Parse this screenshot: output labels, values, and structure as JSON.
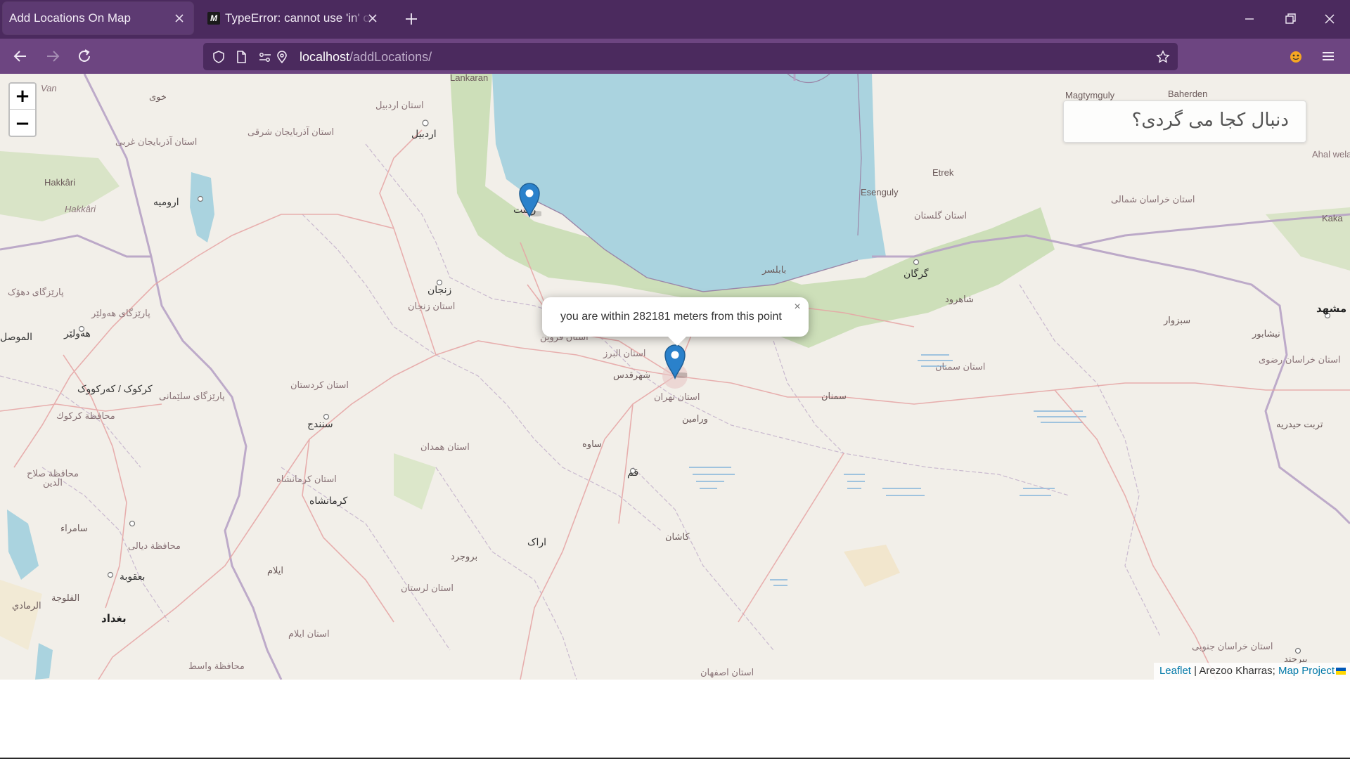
{
  "browser": {
    "tabs": [
      {
        "title": "Add Locations On Map",
        "active": true
      },
      {
        "title": "TypeError: cannot use 'in' operator to search",
        "favicon": "M",
        "active": false
      }
    ],
    "url": {
      "host": "localhost",
      "path": "/addLocations/"
    }
  },
  "colors": {
    "tabbar": "#4b2a5e",
    "navbar": "#6d4581",
    "water": "#aad3df",
    "marker": "#2a81cb"
  },
  "map": {
    "zoom_in_label": "+",
    "zoom_out_label": "−",
    "search_placeholder": "دنبال کجا می گردی؟",
    "popup_text": "you are within 282181 meters from this point",
    "popup_close": "×",
    "attribution": {
      "leaflet": "Leaflet",
      "separator": " | ",
      "author": "Arezoo Kharras; ",
      "project": "Map Project"
    },
    "labels": [
      {
        "text": "Lankaran",
        "cls": ""
      },
      {
        "text": "Magtymguly",
        "cls": ""
      },
      {
        "text": "Baherden",
        "cls": ""
      },
      {
        "text": "Ahal welaý",
        "cls": "prov"
      },
      {
        "text": "Etrek",
        "cls": ""
      },
      {
        "text": "Esenguly",
        "cls": ""
      },
      {
        "text": "Kaka",
        "cls": ""
      },
      {
        "text": "Hakkâri",
        "cls": ""
      },
      {
        "text": "Hakkâri",
        "cls": "prov"
      },
      {
        "text": "Van",
        "cls": "prov"
      },
      {
        "text": "استان اردبیل",
        "cls": "prov"
      },
      {
        "text": "اردبیل",
        "cls": "city"
      },
      {
        "text": "استان آذربایجان شرقی",
        "cls": "prov"
      },
      {
        "text": "استان آذربایجان غربی",
        "cls": "prov"
      },
      {
        "text": "ارومیه",
        "cls": "city"
      },
      {
        "text": "خوی",
        "cls": ""
      },
      {
        "text": "زنجان",
        "cls": "city"
      },
      {
        "text": "استان زنجان",
        "cls": "prov"
      },
      {
        "text": "استان قزوین",
        "cls": "prov"
      },
      {
        "text": "استان البرز",
        "cls": "prov"
      },
      {
        "text": "شهرقدس",
        "cls": ""
      },
      {
        "text": "استان تهران",
        "cls": "prov"
      },
      {
        "text": "ورامین",
        "cls": ""
      },
      {
        "text": "بابلسر",
        "cls": ""
      },
      {
        "text": "گرگان",
        "cls": "city"
      },
      {
        "text": "استان گلستان",
        "cls": "prov"
      },
      {
        "text": "شاهرود",
        "cls": ""
      },
      {
        "text": "سبزوار",
        "cls": ""
      },
      {
        "text": "مشهد",
        "cls": "big"
      },
      {
        "text": "نیشابور",
        "cls": ""
      },
      {
        "text": "استان خراسان شمالی",
        "cls": "prov"
      },
      {
        "text": "استان خراسان رضوی",
        "cls": "prov"
      },
      {
        "text": "استان سمنان",
        "cls": "prov"
      },
      {
        "text": "سمنان",
        "cls": ""
      },
      {
        "text": "تربت حیدریه",
        "cls": ""
      },
      {
        "text": "استان کردستان",
        "cls": "prov"
      },
      {
        "text": "سنندج",
        "cls": "city"
      },
      {
        "text": "کرکوک / کەرکووک",
        "cls": "city"
      },
      {
        "text": "محافظة كركوك",
        "cls": "prov"
      },
      {
        "text": "پارێزگای سلێمانی",
        "cls": "prov"
      },
      {
        "text": "هەولێر",
        "cls": "city"
      },
      {
        "text": "الموصل",
        "cls": "city"
      },
      {
        "text": "پارێزگای هەولێر",
        "cls": "prov"
      },
      {
        "text": "پارێزگای دهۆک",
        "cls": "prov"
      },
      {
        "text": "استان همدان",
        "cls": "prov"
      },
      {
        "text": "ساوه",
        "cls": ""
      },
      {
        "text": "قم",
        "cls": "city"
      },
      {
        "text": "استان کرمانشاه",
        "cls": "prov"
      },
      {
        "text": "کرمانشاه",
        "cls": "city"
      },
      {
        "text": "اراک",
        "cls": "city"
      },
      {
        "text": "کاشان",
        "cls": ""
      },
      {
        "text": "استان لرستان",
        "cls": "prov"
      },
      {
        "text": "بروجرد",
        "cls": ""
      },
      {
        "text": "استان ایلام",
        "cls": "prov"
      },
      {
        "text": "ایلام",
        "cls": ""
      },
      {
        "text": "محافظة صلاح الدين",
        "cls": "prov"
      },
      {
        "text": "محافظة ديالى",
        "cls": "prov"
      },
      {
        "text": "بعقوبة",
        "cls": "city"
      },
      {
        "text": "بغداد",
        "cls": "big"
      },
      {
        "text": "الفلوجة",
        "cls": ""
      },
      {
        "text": "الرمادي",
        "cls": ""
      },
      {
        "text": "محافظة واسط",
        "cls": "prov"
      },
      {
        "text": "استان اصفهان",
        "cls": "prov"
      },
      {
        "text": "استان خراسان جنوبی",
        "cls": "prov"
      },
      {
        "text": "بیرجند",
        "cls": ""
      },
      {
        "text": "سامراء",
        "cls": ""
      },
      {
        "text": "رشت",
        "cls": "city"
      }
    ]
  }
}
